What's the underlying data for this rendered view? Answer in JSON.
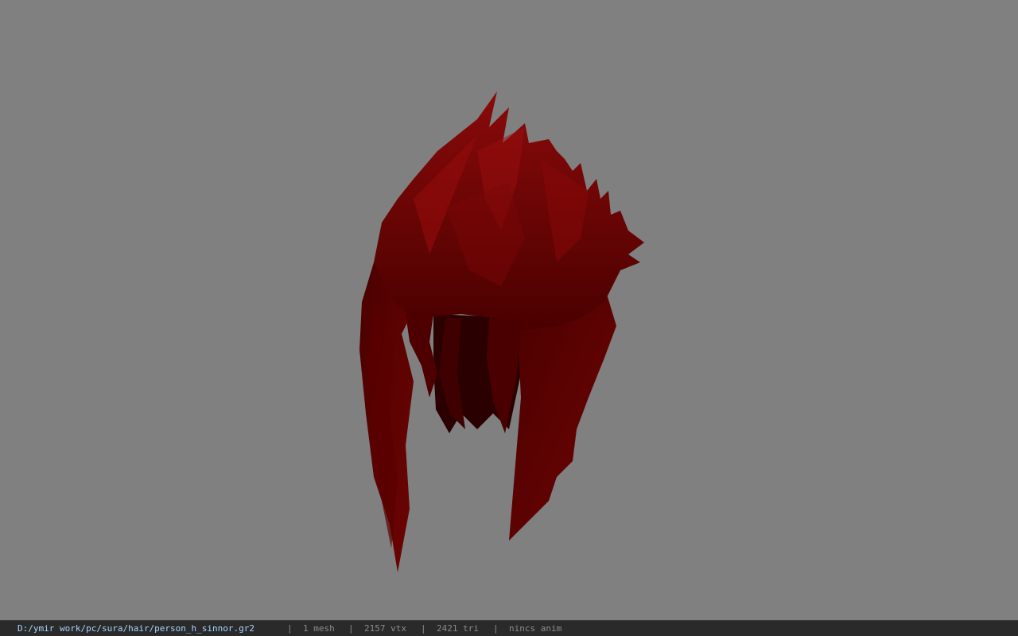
{
  "viewport": {
    "background_color": "#808080",
    "model_name": "hair-mesh",
    "model_color": "#5a0000"
  },
  "status": {
    "file_path": "D:/ymir work/pc/sura/hair/person_h_sinnor.gr2",
    "separator": "|",
    "mesh_count": "1 mesh",
    "vertex_count": "2157 vtx",
    "triangle_count": "2421 tri",
    "anim_status": "nincs anim"
  }
}
